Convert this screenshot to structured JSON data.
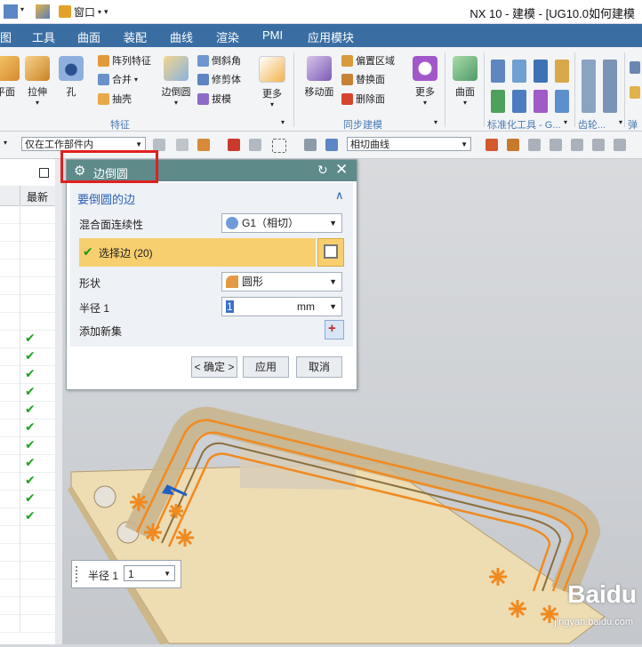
{
  "titlebar": {
    "window_menu": "窗口",
    "app_title": "NX 10 - 建模 - [UG10.0如何建模"
  },
  "menubar": {
    "items": [
      "图",
      "工具",
      "曲面",
      "装配",
      "曲线",
      "渲染",
      "PMI",
      "应用模块"
    ]
  },
  "ribbon": {
    "big_buttons": [
      "平面",
      "拉伸",
      "孔",
      "边倒圆",
      "更多",
      "移动面",
      "更多",
      "曲面"
    ],
    "small_buttons": [
      "阵列特征",
      "合并",
      "抽壳",
      "倒斜角",
      "修剪体",
      "拔模",
      "偏置区域",
      "替换面",
      "删除面"
    ],
    "groups": [
      "特征",
      "同步建模",
      "标准化工具 - G...",
      "齿轮...",
      "弹"
    ]
  },
  "toolbar2": {
    "filter_value": "仅在工作部件内",
    "curve_rule_value": "相切曲线"
  },
  "navigator": {
    "column_header": "最新",
    "checked_rows": 11
  },
  "dialog": {
    "title": "边倒圆",
    "section_title": "要倒圆的边",
    "continuity_label": "混合面连续性",
    "continuity_value": "G1（相切）",
    "select_edge_label": "选择边 (20)",
    "shape_label": "形状",
    "shape_value": "圆形",
    "radius_label": "半径 1",
    "radius_value": "1",
    "radius_unit": "mm",
    "add_set_label": "添加新集",
    "ok_label": "< 确定 >",
    "apply_label": "应用",
    "cancel_label": "取消"
  },
  "viewport": {
    "radius_field_label": "半径 1",
    "radius_field_value": "1"
  },
  "watermark": {
    "brand": "Baidu",
    "url": "jingyan.baidu.com"
  },
  "colors": {
    "menubar": "#3a6ea3",
    "dialog_title": "#5e8a8a",
    "selection": "#f7cf6f",
    "highlight_box": "#e1201f",
    "check": "#1fa31f",
    "edge_orange": "#f08a20"
  }
}
